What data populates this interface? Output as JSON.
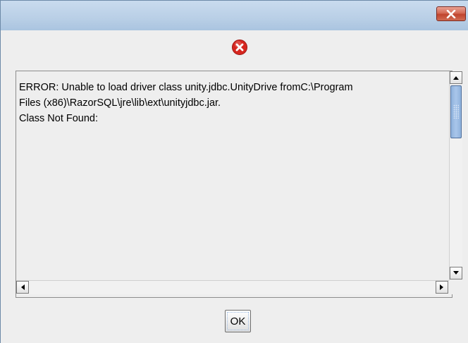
{
  "window": {
    "title": "",
    "close_icon": "close-x-icon"
  },
  "dialog": {
    "icon": "error-icon",
    "message_lines": [
      "ERROR: Unable to load driver class unity.jdbc.UnityDrive fromC:\\Program",
      "Files (x86)\\RazorSQL\\jre\\lib\\ext\\unityjdbc.jar.",
      "Class Not Found:"
    ],
    "ok_label": "OK"
  },
  "colors": {
    "error_red": "#d6261f",
    "close_red": "#c9452e",
    "scroll_thumb": "#9bbce4"
  }
}
